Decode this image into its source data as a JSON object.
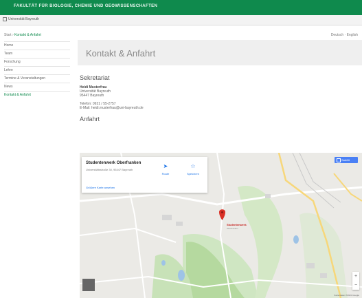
{
  "header": {
    "faculty_title": "FAKULTÄT FÜR BIOLOGIE, CHEMIE UND GEOWISSENSCHAFTEN",
    "uni_label": "Universität Bayreuth"
  },
  "breadcrumb": {
    "home": "Start",
    "current": "Kontakt & Anfahrt"
  },
  "lang_switch": "Deutsch · English",
  "sidebar": {
    "items": [
      {
        "label": "Home"
      },
      {
        "label": "Team"
      },
      {
        "label": "Forschung"
      },
      {
        "label": "Lehre"
      },
      {
        "label": "Termine & Veranstaltungen"
      },
      {
        "label": "News"
      },
      {
        "label": "Kontakt & Anfahrt"
      }
    ],
    "active_index": 6
  },
  "page": {
    "title": "Kontakt & Anfahrt",
    "secretariat_heading": "Sekretariat",
    "address": {
      "name": "Heidi Musterfrau",
      "institution": "Universität Bayreuth",
      "city": "95447 Bayreuth"
    },
    "phone": "Telefon: 0921 / 55-2757",
    "email": "E-Mail: heidi.musterfrau@uni-bayreuth.de",
    "directions_heading": "Anfahrt"
  },
  "map": {
    "place_name": "Studentenwerk Oberfranken",
    "place_address": "Universitätsstraße 30, 95447 Bayreuth",
    "bigger_map_link": "Größere Karte ansehen",
    "route_label": "Route",
    "save_label": "Speichern",
    "mode_button": "Satellit",
    "pin_label": "Studentenwerk",
    "pin_sub": "Oberfranken",
    "attribution": "Kartendaten ©2024 Google",
    "zoom_in": "+",
    "zoom_out": "−"
  },
  "colors": {
    "brand_green": "#0f8a4d",
    "map_blue": "#4a80f5",
    "pin_red": "#d93025"
  }
}
